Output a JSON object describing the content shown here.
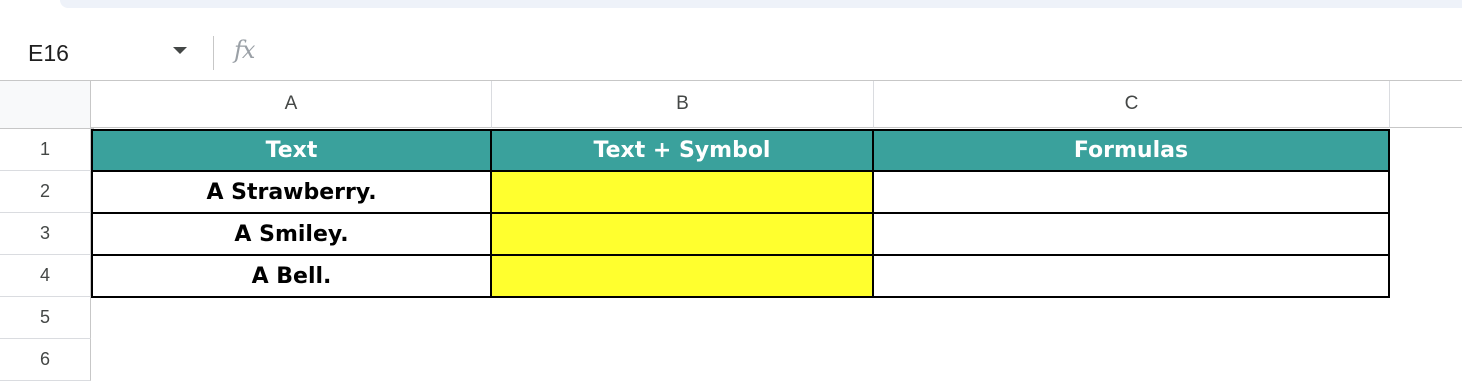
{
  "formula_bar": {
    "name_box": "E16",
    "fx_icon": "fx-icon",
    "formula": ""
  },
  "columns": [
    "A",
    "B",
    "C"
  ],
  "rows": [
    "1",
    "2",
    "3",
    "4",
    "5",
    "6"
  ],
  "table": {
    "headers": [
      "Text",
      "Text + Symbol",
      "Formulas"
    ],
    "rows": [
      {
        "text": "A Strawberry.",
        "symbol": "",
        "formula": ""
      },
      {
        "text": "A Smiley.",
        "symbol": "",
        "formula": ""
      },
      {
        "text": "A Bell.",
        "symbol": "",
        "formula": ""
      }
    ]
  },
  "colors": {
    "header_fill": "#3aa19c",
    "highlight_fill": "#ffff2e"
  }
}
